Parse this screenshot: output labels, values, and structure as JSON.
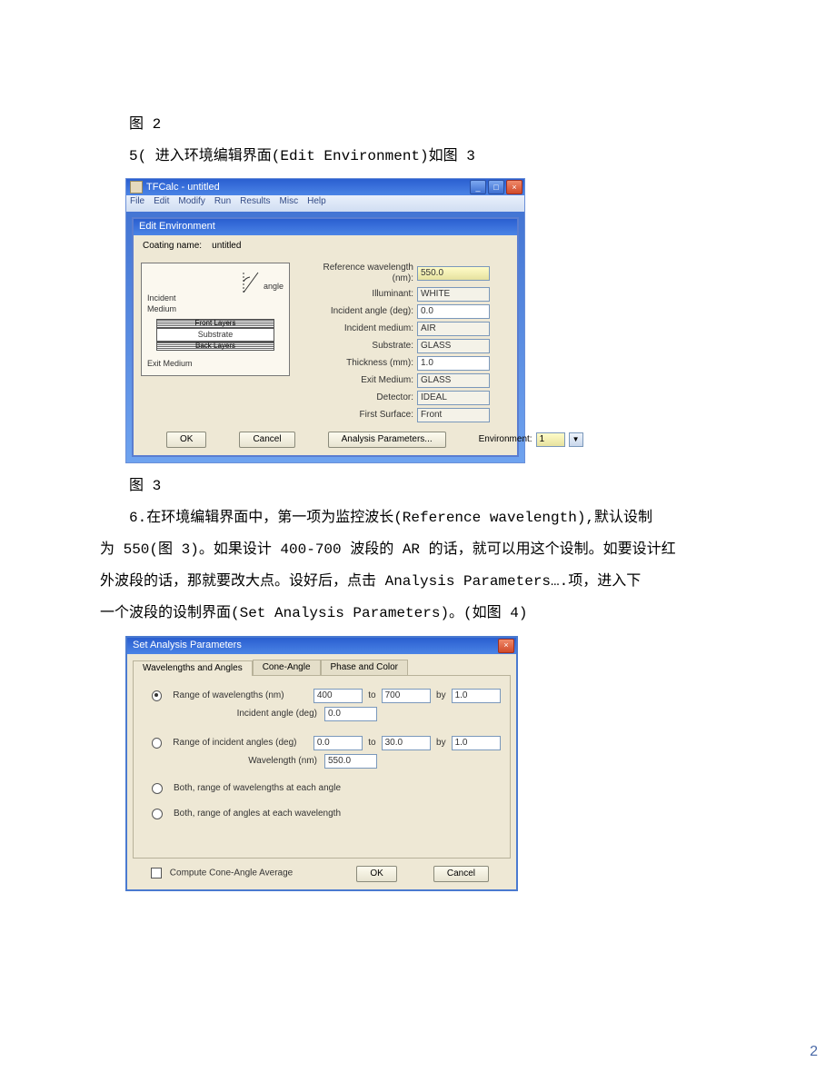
{
  "text": {
    "fig2_caption": "图 2",
    "line5": "5( 进入环境编辑界面(Edit Environment)如图 3",
    "fig3_caption": "图 3",
    "para6a": "6.在环境编辑界面中，第一项为监控波长(Reference wavelength),默认设制",
    "para6b": "为 550(图 3)。如果设计 400-700 波段的 AR 的话，就可以用这个设制。如要设计红",
    "para6c": "外波段的话，那就要改大点。设好后，点击 Analysis Parameters….项，进入下",
    "para6d": "一个波段的设制界面(Set Analysis Parameters)。(如图 4)",
    "page_num": "2"
  },
  "fig3": {
    "window_title": "TFCalc - untitled",
    "menu": [
      "File",
      "Edit",
      "Modify",
      "Run",
      "Results",
      "Misc",
      "Help"
    ],
    "dialog_title": "Edit Environment",
    "coating_label": "Coating name:",
    "coating_value": "untitled",
    "diagram": {
      "angle": "angle",
      "incident": "Incident",
      "medium": "Medium",
      "front_layers": "Front Layers",
      "substrate": "Substrate",
      "back_layers": "Back Layers",
      "exit_medium": "Exit Medium"
    },
    "fields": [
      {
        "label": "Reference wavelength (nm):",
        "value": "550.0",
        "hl": true
      },
      {
        "label": "Illuminant:",
        "value": "WHITE",
        "ro": true
      },
      {
        "label": "Incident angle (deg):",
        "value": "0.0"
      },
      {
        "label": "Incident medium:",
        "value": "AIR",
        "ro": true
      },
      {
        "label": "Substrate:",
        "value": "GLASS",
        "ro": true
      },
      {
        "label": "Thickness (mm):",
        "value": "1.0"
      },
      {
        "label": "Exit Medium:",
        "value": "GLASS",
        "ro": true
      },
      {
        "label": "Detector:",
        "value": "IDEAL",
        "ro": true
      },
      {
        "label": "First Surface:",
        "value": "Front",
        "ro": true
      }
    ],
    "buttons": {
      "ok": "OK",
      "cancel": "Cancel",
      "analysis": "Analysis Parameters...",
      "env_label": "Environment:",
      "env_value": "1"
    }
  },
  "fig4": {
    "title": "Set Analysis Parameters",
    "tabs": [
      "Wavelengths and Angles",
      "Cone-Angle",
      "Phase and Color"
    ],
    "row1": {
      "label": "Range of wavelengths (nm)",
      "from": "400",
      "to_label": "to",
      "to": "700",
      "by_label": "by",
      "by": "1.0"
    },
    "row1b": {
      "label": "Incident angle (deg)",
      "val": "0.0"
    },
    "row2": {
      "label": "Range of incident angles (deg)",
      "from": "0.0",
      "to_label": "to",
      "to": "30.0",
      "by_label": "by",
      "by": "1.0"
    },
    "row2b": {
      "label": "Wavelength (nm)",
      "val": "550.0"
    },
    "opt3": "Both, range of wavelengths at each angle",
    "opt4": "Both, range of angles at each wavelength",
    "compute": "Compute Cone-Angle Average",
    "ok": "OK",
    "cancel": "Cancel"
  }
}
